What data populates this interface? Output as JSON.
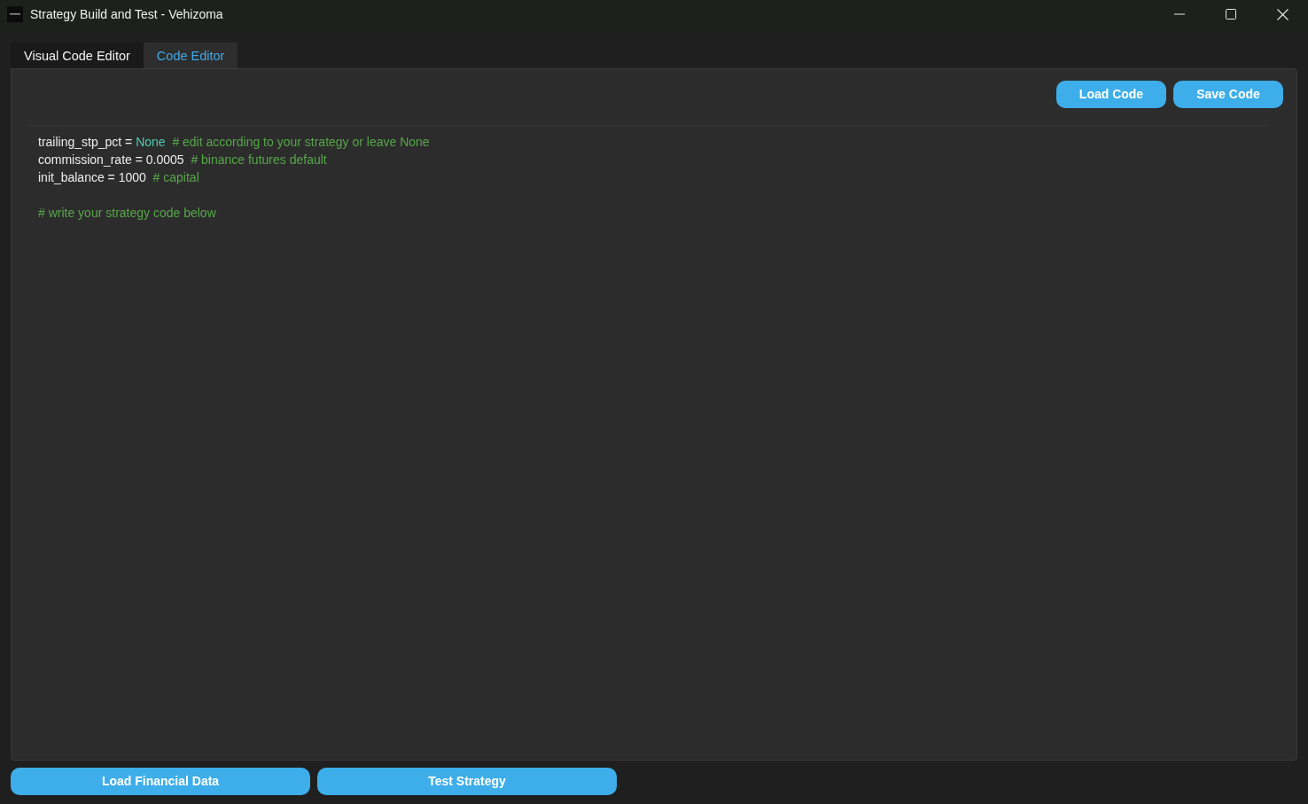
{
  "window": {
    "title": "Strategy Build and Test - Vehizoma"
  },
  "tabs": [
    {
      "label": "Visual Code Editor",
      "selected": false
    },
    {
      "label": "Code Editor",
      "selected": true
    }
  ],
  "toolbar_buttons": [
    "Load Code",
    "Save Code"
  ],
  "code_blocks": [
    {
      "lines": [
        {
          "tokens": [
            {
              "kind": "plain",
              "text": "trailing_stp_pct ="
            },
            {
              "kind": "constant",
              "text": "None"
            },
            {
              "kind": "comment",
              "text": "# edit according to your strategy or leave None"
            }
          ]
        },
        {
          "tokens": [
            {
              "kind": "plain",
              "text": "commission_rate = 0.0005"
            },
            {
              "kind": "comment",
              "text": "# binance futures default"
            }
          ]
        },
        {
          "tokens": [
            {
              "kind": "plain",
              "text": "init_balance = 1000"
            },
            {
              "kind": "comment",
              "text": "# capital"
            }
          ]
        }
      ]
    },
    {
      "lines": [
        {
          "tokens": [
            {
              "kind": "comment",
              "text": "# write your strategy code below"
            }
          ]
        }
      ]
    }
  ],
  "bottom_buttons": [
    "Load Financial Data",
    "Test Strategy"
  ]
}
